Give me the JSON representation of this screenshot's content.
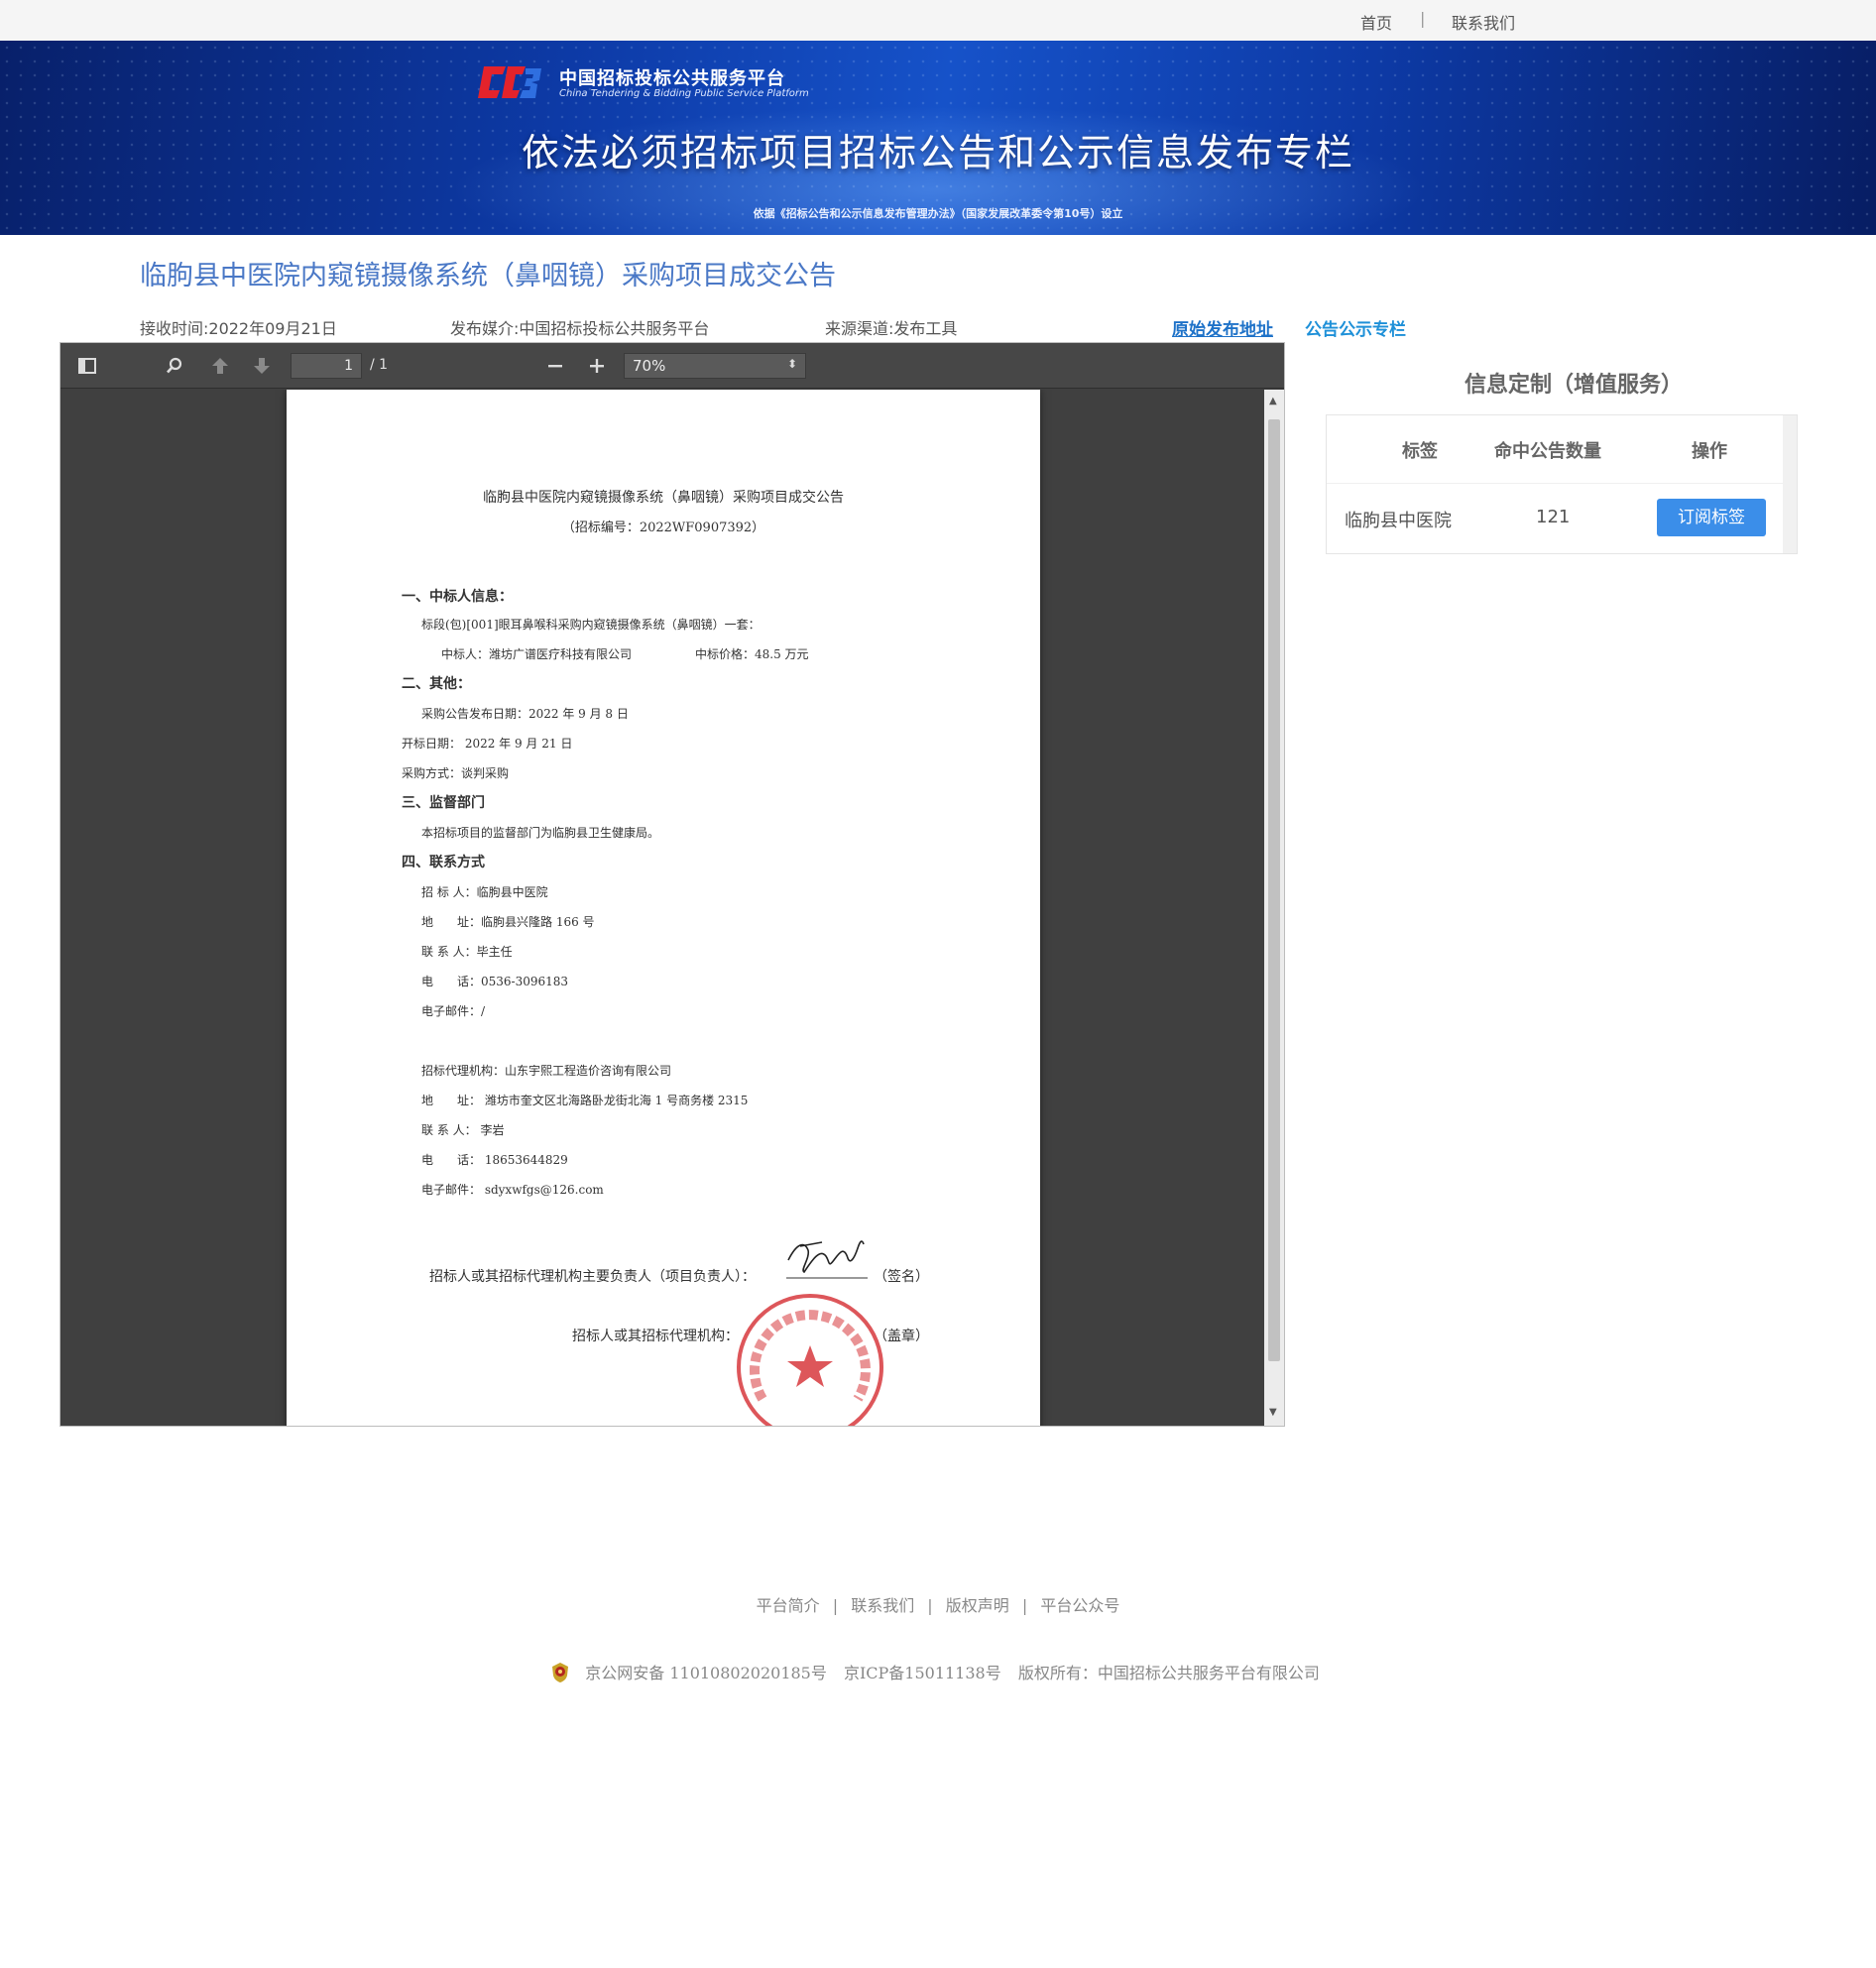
{
  "topnav": {
    "home": "首页",
    "separator": "|",
    "contact": "联系我们"
  },
  "banner": {
    "logo_cn": "中国招标投标公共服务平台",
    "logo_en": "China Tendering & Bidding Public Service Platform",
    "title": "依法必须招标项目招标公告和公示信息发布专栏",
    "subtitle": "依据《招标公告和公示信息发布管理办法》（国家发展改革委令第10号）设立"
  },
  "article": {
    "title": "临朐县中医院内窥镜摄像系统（鼻咽镜）采购项目成交公告",
    "received": "接收时间:2022年09月21日",
    "media": "发布媒介:中国招标投标公共服务平台",
    "channel": "来源渠道:发布工具",
    "original_link": "原始发布地址",
    "column_link": "公告公示专栏"
  },
  "viewer": {
    "page_current": "1",
    "page_total": "/ 1",
    "zoom": "70%",
    "icons": [
      "sidebar-toggle-icon",
      "search-icon",
      "arrow-up-icon",
      "arrow-down-icon",
      "zoom-out-icon",
      "zoom-in-icon"
    ]
  },
  "document": {
    "title": "临朐县中医院内窥镜摄像系统（鼻咽镜）采购项目成交公告",
    "number": "（招标编号：2022WF0907392）",
    "sec1": "一、中标人信息：",
    "sec1_l1": "标段(包)[001]眼耳鼻喉科采购内窥镜摄像系统（鼻咽镜）一套：",
    "sec1_l2a": "中标人：潍坊广谱医疗科技有限公司",
    "sec1_l2b": "中标价格：48.5 万元",
    "sec2": "二、其他：",
    "sec2_l1": "采购公告发布日期：2022 年 9 月 8 日",
    "sec2_l2": "开标日期： 2022 年 9 月 21 日",
    "sec2_l3": "采购方式：谈判采购",
    "sec3": "三、监督部门",
    "sec3_l1": "本招标项目的监督部门为临朐县卫生健康局。",
    "sec4": "四、联系方式",
    "c1": "招 标 人：临朐县中医院",
    "c2": "地　　址：临朐县兴隆路 166 号",
    "c3": "联 系 人：毕主任",
    "c4": "电　　话：0536-3096183",
    "c5": "电子邮件：/",
    "a1": "招标代理机构：山东宇熙工程造价咨询有限公司",
    "a2": "地　　址： 潍坊市奎文区北海路卧龙街北海 1 号商务楼 2315",
    "a3": "联 系 人： 李岩",
    "a4": "电　　话： 18653644829",
    "a5": "电子邮件： sdyxwfgs@126.com",
    "sign_line": "招标人或其招标代理机构主要负责人（项目负责人）：",
    "sign_suffix": "（签名）",
    "stamp_line": "招标人或其招标代理机构：",
    "stamp_suffix": "（盖章）",
    "stamp_text": "山东宇熙工程造价咨询有限公司"
  },
  "panel": {
    "title": "信息定制（增值服务）",
    "headers": [
      "标签",
      "命中公告数量",
      "操作"
    ],
    "rows": [
      {
        "tag": "临朐县中医院",
        "count": "121",
        "action": "订阅标签"
      }
    ]
  },
  "footer": {
    "links": [
      "平台简介",
      "联系我们",
      "版权声明",
      "平台公众号"
    ],
    "separator": "|",
    "beian": "京公网安备 11010802020185号",
    "icp": "京ICP备15011138号",
    "copyright": "版权所有：中国招标公共服务平台有限公司"
  },
  "colors": {
    "accent": "#3b8ee9",
    "title_blue": "#4a78c6",
    "link_blue": "#1e72c8",
    "stamp_red": "#d7383d"
  }
}
